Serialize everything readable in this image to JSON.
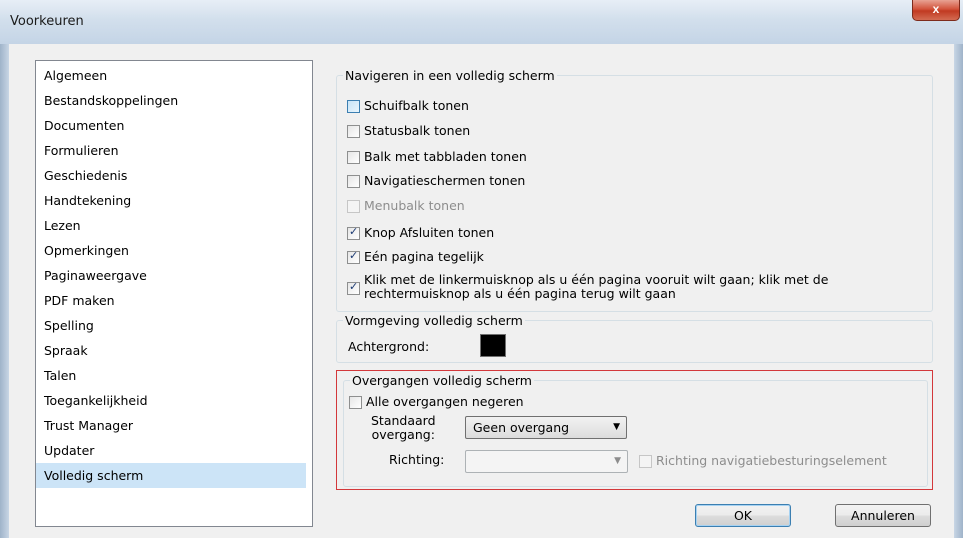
{
  "window": {
    "title": "Voorkeuren",
    "close_label": "x"
  },
  "categories": [
    "Algemeen",
    "Bestandskoppelingen",
    "Documenten",
    "Formulieren",
    "Geschiedenis",
    "Handtekening",
    "Lezen",
    "Opmerkingen",
    "Paginaweergave",
    "PDF maken",
    "Spelling",
    "Spraak",
    "Talen",
    "Toegankelijkheid",
    "Trust Manager",
    "Updater",
    "Volledig scherm"
  ],
  "selected_category": "Volledig scherm",
  "nav_group": {
    "legend": "Navigeren in een volledig scherm",
    "options": [
      {
        "label": "Schuifbalk tonen",
        "checked": false,
        "enabled": true
      },
      {
        "label": "Statusbalk tonen",
        "checked": false,
        "enabled": true
      },
      {
        "label": "Balk met tabbladen tonen",
        "checked": false,
        "enabled": true
      },
      {
        "label": "Navigatieschermen tonen",
        "checked": false,
        "enabled": true
      },
      {
        "label": "Menubalk tonen",
        "checked": false,
        "enabled": false
      },
      {
        "label": "Knop Afsluiten tonen",
        "checked": true,
        "enabled": true
      },
      {
        "label": "Eén pagina tegelijk",
        "checked": true,
        "enabled": true
      },
      {
        "label": "Klik met de linkermuisknop als u één pagina vooruit wilt gaan; klik met de",
        "label_line2": "rechtermuisknop als u één pagina terug wilt gaan",
        "checked": true,
        "enabled": true
      }
    ]
  },
  "appearance_group": {
    "legend": "Vormgeving volledig scherm",
    "background_label": "Achtergrond:",
    "background_color": "#000000"
  },
  "transitions_group": {
    "legend": "Overgangen volledig scherm",
    "ignore_all_label": "Alle overgangen negeren",
    "ignore_all_checked": false,
    "default_transition_label_line1": "Standaard",
    "default_transition_label_line2": "overgang:",
    "default_transition_value": "Geen overgang",
    "direction_label": "Richting:",
    "direction_value": "",
    "nav_control_direction_label": "Richting navigatiebesturingselement"
  },
  "buttons": {
    "ok": "OK",
    "cancel": "Annuleren"
  }
}
